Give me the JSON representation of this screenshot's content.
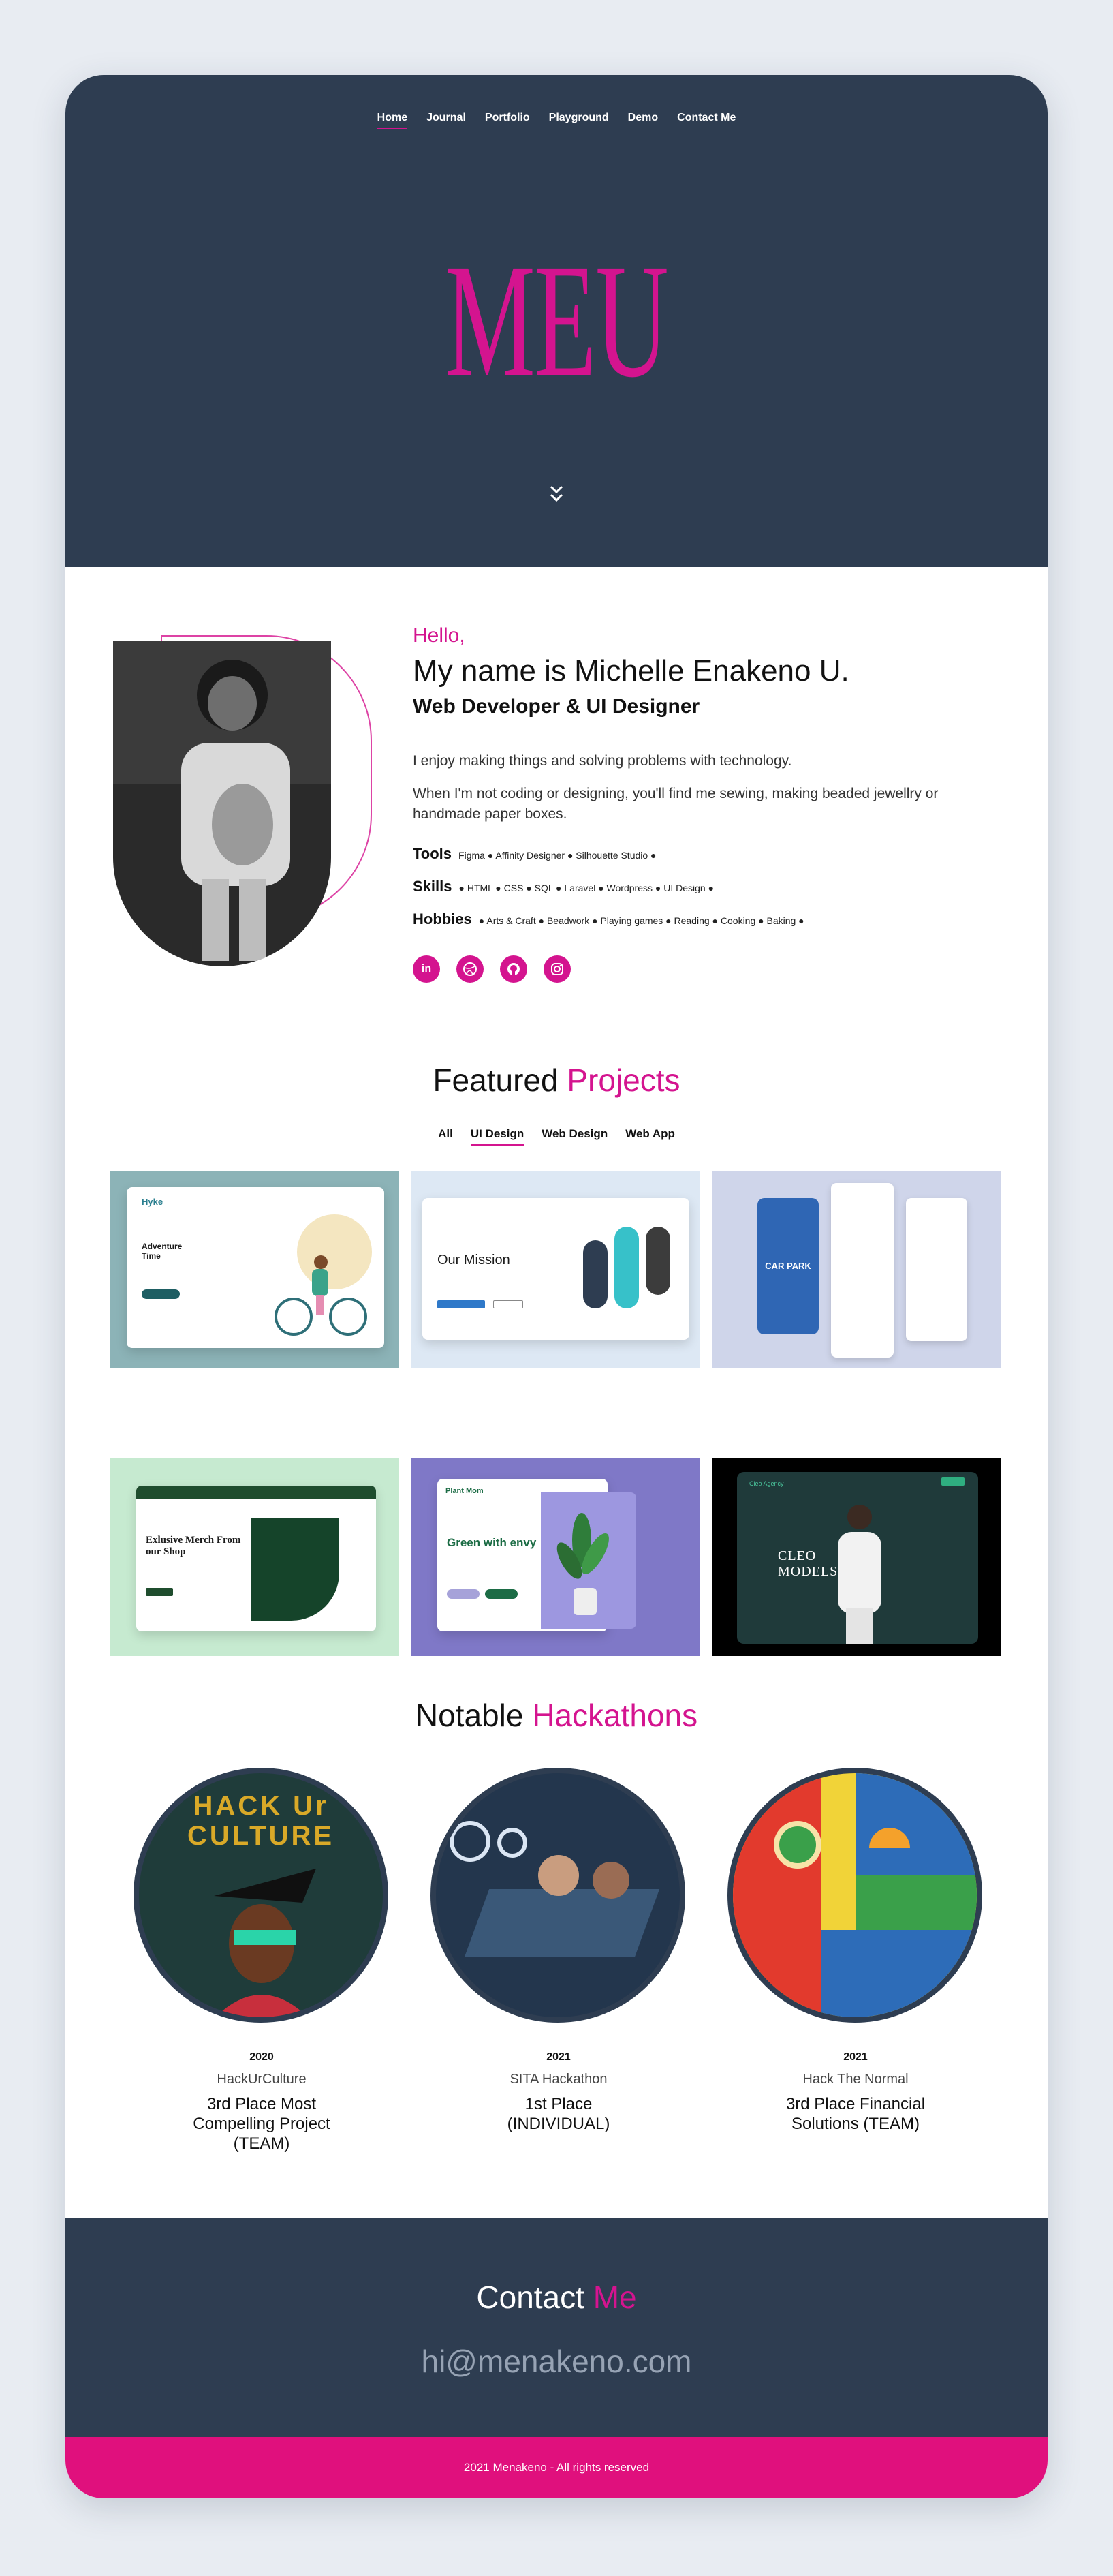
{
  "nav": {
    "items": [
      "Home",
      "Journal",
      "Portfolio",
      "Playground",
      "Demo",
      "Contact Me"
    ],
    "active": "Home"
  },
  "hero": {
    "logo": "MEU"
  },
  "about": {
    "hello": "Hello,",
    "name": "My name is Michelle Enakeno U.",
    "role": "Web Developer & UI Designer",
    "para1": "I enjoy making things and solving problems with technology.",
    "para2": "When I'm not coding or designing, you'll find me sewing, making beaded jewellry or handmade paper boxes.",
    "tools_label": "Tools",
    "tools": "Figma ● Affinity Designer ● Silhouette Studio ●",
    "skills_label": "Skills",
    "skills": "● HTML ● CSS ● SQL ● Laravel ● Wordpress ● UI Design ●",
    "hobbies_label": "Hobbies",
    "hobbies": "● Arts & Craft ● Beadwork ● Playing games ● Reading ● Cooking ● Baking ●",
    "socials": [
      "linkedin-icon",
      "dribbble-icon",
      "github-icon",
      "instagram-icon"
    ]
  },
  "projects": {
    "title": "Featured",
    "title_accent": "Projects",
    "tabs": [
      "All",
      "UI Design",
      "Web Design",
      "Web App"
    ],
    "active_tab": "UI Design",
    "cards": [
      {
        "bg": "#8cb3b7",
        "caption": "Hyke",
        "headline": "Adventure Time"
      },
      {
        "bg": "#dde8f4",
        "caption": "",
        "headline": "Our Mission"
      },
      {
        "bg": "#cfd5ea",
        "caption": "CAR PARK",
        "headline": ""
      },
      {
        "bg": "#c6ead0",
        "caption": "",
        "headline": "Exlusive Merch From our Shop"
      },
      {
        "bg": "#7f78c7",
        "caption": "Plant Mom",
        "headline": "Green with envy"
      },
      {
        "bg": "#000000",
        "caption": "Cleo Agency",
        "headline": "CLEO MODELS"
      }
    ]
  },
  "hackathons": {
    "title": "Notable",
    "title_accent": "Hackathons",
    "items": [
      {
        "year": "2020",
        "event": "HackUrCulture",
        "award": "3rd Place Most Compelling Project (TEAM)",
        "art": "HACK Ur CULTURE"
      },
      {
        "year": "2021",
        "event": "SITA Hackathon",
        "award": "1st Place (INDIVIDUAL)",
        "art": ""
      },
      {
        "year": "2021",
        "event": "Hack The Normal",
        "award": "3rd Place Financial Solutions (TEAM)",
        "art": ""
      }
    ]
  },
  "contact": {
    "title": "Contact",
    "title_accent": "Me",
    "email": "hi@menakeno.com"
  },
  "footer": {
    "text": "2021 Menakeno - All rights reserved"
  },
  "colors": {
    "navy": "#2e3d51",
    "accent": "#d4148f",
    "footer": "#e0107d"
  }
}
